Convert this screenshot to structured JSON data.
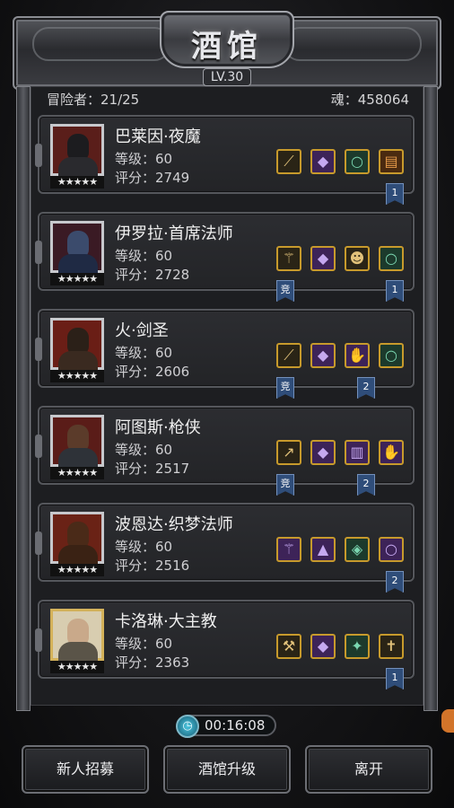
{
  "header": {
    "title": "酒馆",
    "level": "LV.30"
  },
  "stats": {
    "adventurers": "冒险者：21/25",
    "souls": "魂：458064"
  },
  "heroes": [
    {
      "name": "巴莱因·夜魔",
      "level": "等级：60",
      "score": "评分：2749",
      "stars": "★★★★★",
      "tag_right": "1",
      "tag_jing": ""
    },
    {
      "name": "伊罗拉·首席法师",
      "level": "等级：60",
      "score": "评分：2728",
      "stars": "★★★★★",
      "tag_right": "1",
      "tag_jing": "竞"
    },
    {
      "name": "火·剑圣",
      "level": "等级：60",
      "score": "评分：2606",
      "stars": "★★★★★",
      "tag_right": "2",
      "tag_jing": "竞"
    },
    {
      "name": "阿图斯·枪侠",
      "level": "等级：60",
      "score": "评分：2517",
      "stars": "★★★★★",
      "tag_right": "2",
      "tag_jing": "竞"
    },
    {
      "name": "波恩达·织梦法师",
      "level": "等级：60",
      "score": "评分：2516",
      "stars": "★★★★★",
      "tag_right": "2",
      "tag_jing": ""
    },
    {
      "name": "卡洛琳·大主教",
      "level": "等级：60",
      "score": "评分：2363",
      "stars": "★★★★★",
      "tag_right": "1",
      "tag_jing": ""
    }
  ],
  "timer": "00:16:08",
  "buttons": {
    "recruit": "新人招募",
    "upgrade": "酒馆升级",
    "leave": "离开"
  }
}
